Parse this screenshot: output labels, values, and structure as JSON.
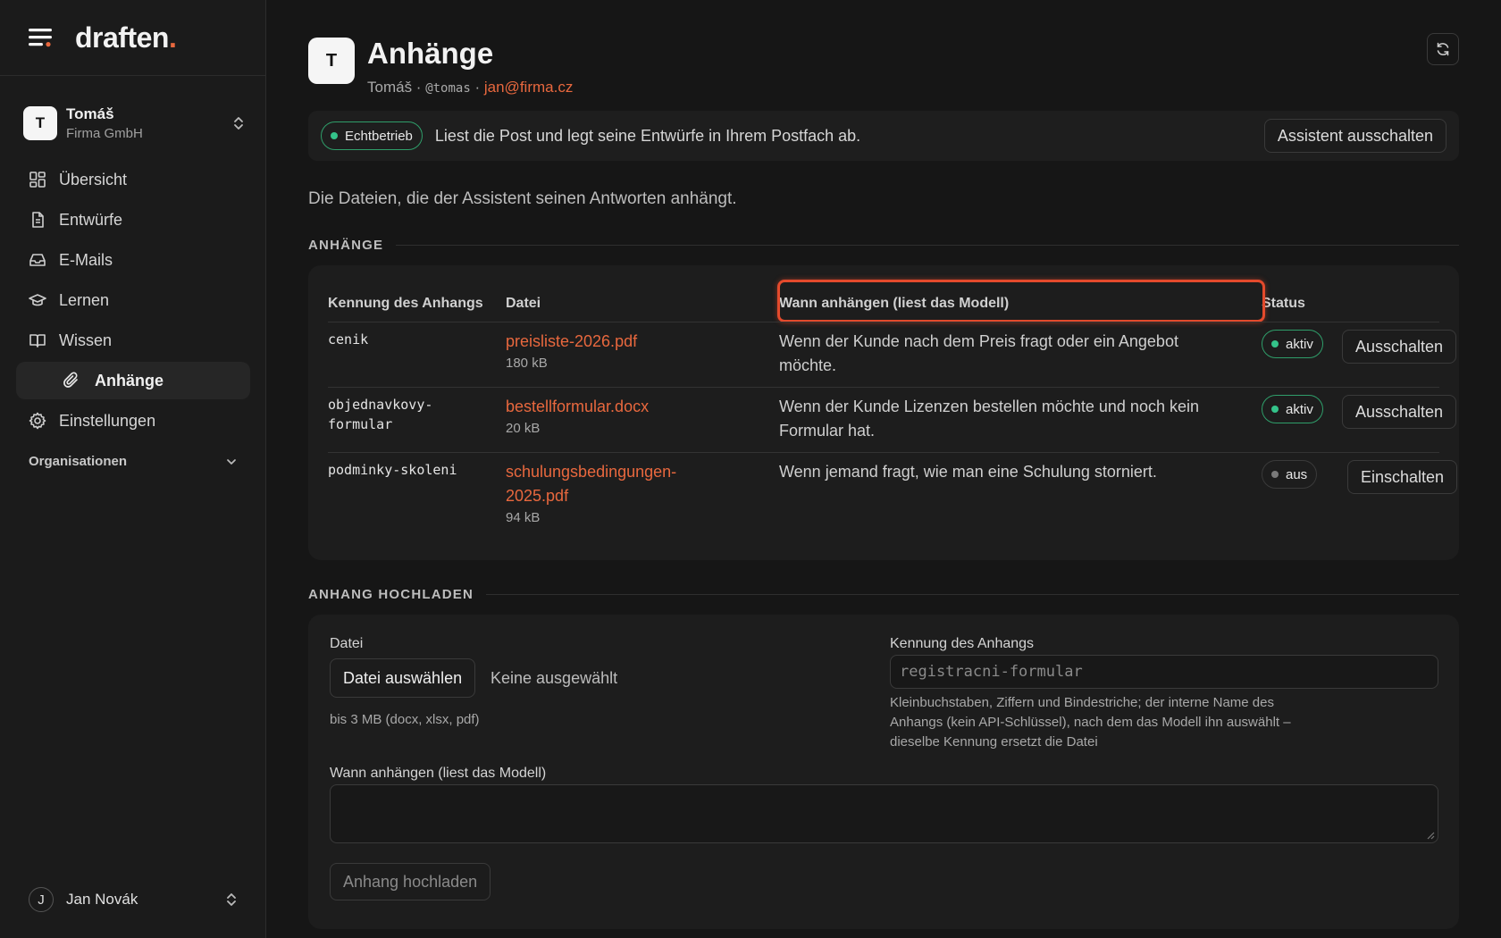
{
  "brand": {
    "name": "draften",
    "dot": "."
  },
  "account": {
    "initial": "T",
    "name": "Tomáš",
    "org": "Firma GmbH"
  },
  "nav": {
    "items": [
      {
        "label": "Übersicht",
        "icon": "dashboard-icon"
      },
      {
        "label": "Entwürfe",
        "icon": "document-icon"
      },
      {
        "label": "E-Mails",
        "icon": "inbox-icon"
      },
      {
        "label": "Lernen",
        "icon": "graduation-cap-icon"
      },
      {
        "label": "Wissen",
        "icon": "book-icon"
      },
      {
        "label": "Anhänge",
        "icon": "paperclip-icon",
        "active": true
      },
      {
        "label": "Einstellungen",
        "icon": "gear-icon"
      }
    ],
    "section": "Organisationen"
  },
  "footer_user": {
    "initial": "J",
    "name": "Jan Novák"
  },
  "header": {
    "initial": "T",
    "title": "Anhänge",
    "name": "Tomáš",
    "sep": " · ",
    "handle": "@tomas",
    "email": "jan@firma.cz"
  },
  "status": {
    "badge": "Echtbetrieb",
    "message": "Liest die Post und legt seine Entwürfe in Ihrem Postfach ab.",
    "button": "Assistent ausschalten"
  },
  "lead": "Die Dateien, die der Assistent seinen Antworten anhängt.",
  "attachments": {
    "section_title": "ANHÄNGE",
    "columns": [
      "Kennung des Anhangs",
      "Datei",
      "Wann anhängen (liest das Modell)",
      "Status"
    ],
    "rows": [
      {
        "id_line1": "cenik",
        "id_line2": "",
        "file_line1": "preisliste-2026.pdf",
        "file_line2": "",
        "size": "180 kB",
        "when": "Wenn der Kunde nach dem Preis fragt oder ein Angebot möchte.",
        "status": "aktiv",
        "action": "Ausschalten",
        "status_color": "#34c38a"
      },
      {
        "id_line1": "objednavkovy-",
        "id_line2": "formular",
        "file_line1": "bestellformular.docx",
        "file_line2": "",
        "size": "20 kB",
        "when": "Wenn der Kunde Lizenzen bestellen möchte und noch kein Formular hat.",
        "status": "aktiv",
        "action": "Ausschalten",
        "status_color": "#34c38a"
      },
      {
        "id_line1": "podminky-skoleni",
        "id_line2": "",
        "file_line1": "schulungsbedingungen-",
        "file_line2": "2025.pdf",
        "size": "94 kB",
        "when": "Wenn jemand fragt, wie man eine Schulung storniert.",
        "status": "aus",
        "action": "Einschalten",
        "status_color": "#7a7a7a"
      }
    ]
  },
  "upload": {
    "section_title": "ANHANG HOCHLADEN",
    "file_label": "Datei",
    "choose_button": "Datei auswählen",
    "no_file": "Keine ausgewählt",
    "file_hint": "bis 3 MB (docx, xlsx, pdf)",
    "id_label": "Kennung des Anhangs",
    "id_placeholder": "registracni-formular",
    "id_hint": "Kleinbuchstaben, Ziffern und Bindestriche; der interne Name des Anhangs (kein API-Schlüssel), nach dem das Modell ihn auswählt – dieselbe Kennung ersetzt die Datei",
    "when_label": "Wann anhängen (liest das Modell)",
    "when_value": "",
    "submit": "Anhang hochladen"
  },
  "colors": {
    "accent": "#e8683e",
    "active_green": "#34c38a",
    "highlight": "#e44a2c",
    "background": "#161616"
  }
}
